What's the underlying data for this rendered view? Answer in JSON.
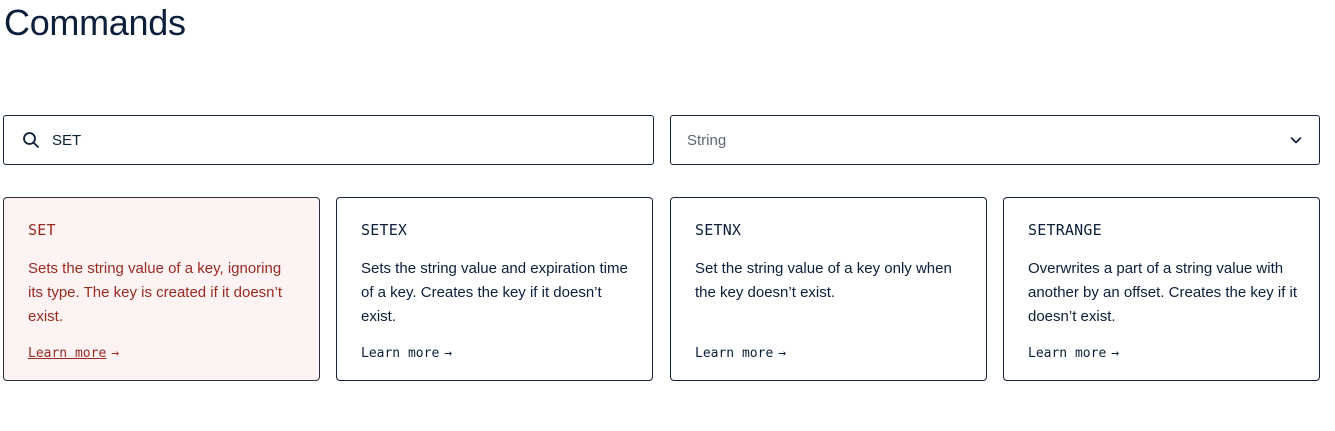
{
  "page": {
    "title": "Commands"
  },
  "search": {
    "value": "SET",
    "icon": "search-icon"
  },
  "filter": {
    "selected": "String",
    "icon": "chevron-down-icon"
  },
  "colors": {
    "text": "#0b1e3a",
    "active_text": "#9b2a22",
    "active_background": "#fcf3f2",
    "border": "#16243a"
  },
  "commands": [
    {
      "name": "SET",
      "description": "Sets the string value of a key, ignoring its type. The key is created if it doesn’t exist.",
      "link": "Learn more",
      "arrow": "→",
      "active": true
    },
    {
      "name": "SETEX",
      "description": "Sets the string value and expiration time of a key. Creates the key if it doesn’t exist.",
      "link": "Learn more",
      "arrow": "→",
      "active": false
    },
    {
      "name": "SETNX",
      "description": "Set the string value of a key only when the key doesn’t exist.",
      "link": "Learn more",
      "arrow": "→",
      "active": false
    },
    {
      "name": "SETRANGE",
      "description": "Overwrites a part of a string value with another by an offset. Creates the key if it doesn’t exist.",
      "link": "Learn more",
      "arrow": "→",
      "active": false
    }
  ]
}
